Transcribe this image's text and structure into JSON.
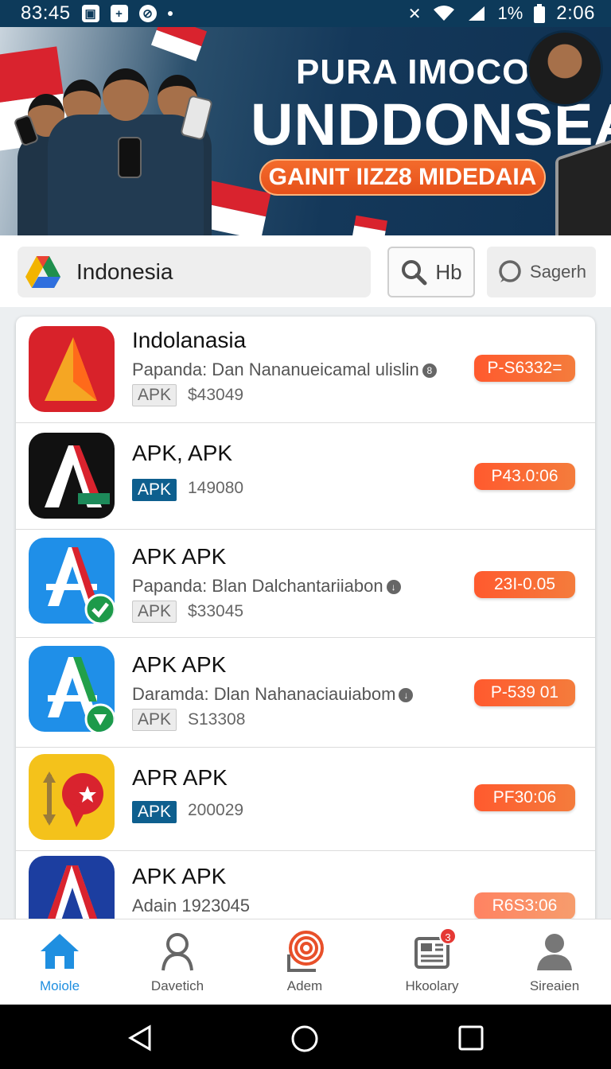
{
  "status_bar": {
    "time_left": "83:45",
    "battery_text": "1%",
    "time_right": "2:06"
  },
  "banner": {
    "line1": "PURA IMOCOAN",
    "line2": "UNDDONSEA",
    "cta": "GAINIT IIZZ8 MIDEDAIA"
  },
  "search": {
    "region_label": "Indonesia",
    "search_button_label": "Hb",
    "secondary_button_label": "Sagerh"
  },
  "apps": [
    {
      "name": "Indolanasia",
      "desc": "Papanda: Dan Nananueicamal ulislin",
      "tag": "APK",
      "tag_style": "gray",
      "meta": "$43049",
      "price": "P-S6332="
    },
    {
      "name": "APK, APK",
      "desc": "",
      "tag": "APK",
      "tag_style": "blue",
      "meta": "149080",
      "price": "P43.0:06"
    },
    {
      "name": "APK APK",
      "desc": "Papanda: Blan Dalchantariiabon",
      "tag": "APK",
      "tag_style": "gray",
      "meta": "$33045",
      "price": "23I-0.05"
    },
    {
      "name": "APK APK",
      "desc": "Daramda: Dlan Nahanaciauiabom",
      "tag": "APK",
      "tag_style": "gray",
      "meta": "S13308",
      "price": "P-539 01"
    },
    {
      "name": "APR APK",
      "desc": "",
      "tag": "APK",
      "tag_style": "blue",
      "meta": "200029",
      "price": "PF30:06"
    },
    {
      "name": "APK APK",
      "desc": "Adain 1923045",
      "tag": "",
      "tag_style": "",
      "meta": "",
      "price": "R6S3:06"
    }
  ],
  "bottom_nav": {
    "items": [
      {
        "label": "Moiole",
        "icon": "home-icon",
        "active": true
      },
      {
        "label": "Davetich",
        "icon": "user-search-icon"
      },
      {
        "label": "Adem",
        "icon": "spiral-icon"
      },
      {
        "label": "Hkoolary",
        "icon": "news-icon",
        "badge": "3"
      },
      {
        "label": "Sireaien",
        "icon": "profile-icon"
      }
    ]
  },
  "colors": {
    "accent": "#f2602a",
    "nav_active": "#1f8fe0",
    "tag_blue": "#0e5f8e",
    "banner_bg": "#14385a"
  }
}
